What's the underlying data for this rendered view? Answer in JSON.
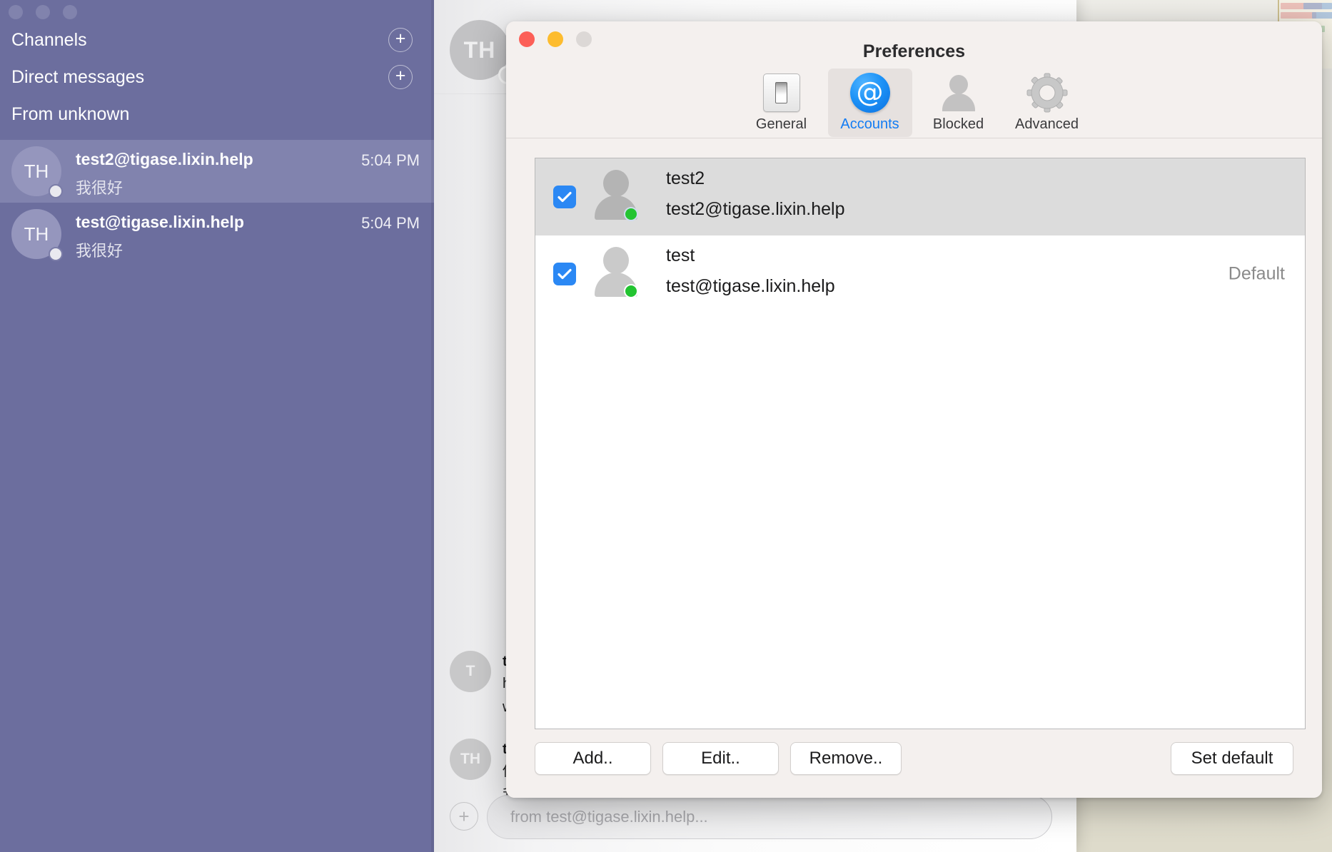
{
  "background": {
    "editor_name": "code-editor-window",
    "document_name": "document-window"
  },
  "sidebar": {
    "sections": [
      {
        "label": "Channels",
        "add_icon": "+"
      },
      {
        "label": "Direct messages",
        "add_icon": "+"
      },
      {
        "label": "From unknown",
        "add_icon": ""
      }
    ],
    "conversations": [
      {
        "initials": "TH",
        "name": "test2@tigase.lixin.help",
        "preview": "我很好",
        "time": "5:04 PM",
        "selected": true
      },
      {
        "initials": "TH",
        "name": "test@tigase.lixin.help",
        "preview": "我很好",
        "time": "5:04 PM",
        "selected": false
      }
    ]
  },
  "chat": {
    "header_avatar_initials": "TH",
    "messages": [
      {
        "initials": "T",
        "name": "te",
        "line1": "h",
        "line2": "w"
      },
      {
        "initials": "TH",
        "name": "te",
        "line1": "你",
        "line2": "我很好"
      }
    ],
    "composer": {
      "add_icon": "+",
      "placeholder": "from test@tigase.lixin.help..."
    }
  },
  "preferences": {
    "title": "Preferences",
    "window_buttons": {
      "close": "close",
      "minimize": "minimize",
      "zoom": "zoom"
    },
    "toolbar": [
      {
        "label": "General",
        "icon": "light-switch-icon",
        "active": false
      },
      {
        "label": "Accounts",
        "icon": "at-sign-icon",
        "active": true
      },
      {
        "label": "Blocked",
        "icon": "person-icon",
        "active": false
      },
      {
        "label": "Advanced",
        "icon": "gear-icon",
        "active": false
      }
    ],
    "accounts": [
      {
        "checked": true,
        "name": "test2",
        "jid": "test2@tigase.lixin.help",
        "status": "online",
        "default_label": "",
        "selected": true
      },
      {
        "checked": true,
        "name": "test",
        "jid": "test@tigase.lixin.help",
        "status": "online",
        "default_label": "Default",
        "selected": false
      }
    ],
    "buttons": {
      "add": "Add..",
      "edit": "Edit..",
      "remove": "Remove..",
      "set_default": "Set default"
    }
  },
  "colors": {
    "sidebar_bg": "#6c6e9e",
    "sidebar_selected": "#8183ae",
    "accent_blue": "#137cf3",
    "checkbox_blue": "#2b88f4",
    "online_green": "#23c431",
    "dialog_bg": "#f4f0ee",
    "row_selected": "#dcdcdc"
  }
}
